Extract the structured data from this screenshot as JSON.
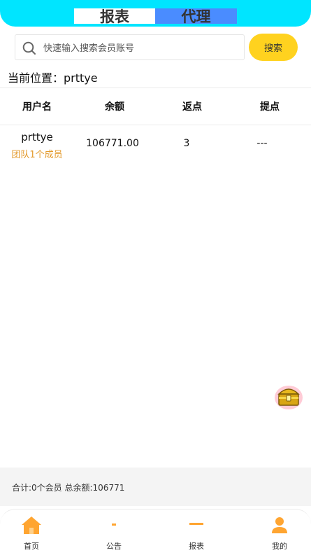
{
  "header": {
    "tabs": [
      {
        "label": "报表"
      },
      {
        "label": "代理"
      }
    ]
  },
  "search": {
    "placeholder": "快速输入搜索会员账号",
    "button_label": "搜索"
  },
  "location": {
    "text": "当前位置：prttye"
  },
  "table": {
    "columns": [
      "用户名",
      "余额",
      "返点",
      "提点"
    ],
    "rows": [
      {
        "username": "prttye",
        "team": "团队1个成员",
        "balance": "106771.00",
        "rebate": "3",
        "commission": "---"
      }
    ]
  },
  "summary": {
    "text": "合计:0个会员 总余额:106771"
  },
  "bottom_nav": {
    "items": [
      {
        "label": "首页",
        "icon": "home-icon"
      },
      {
        "label": "公告",
        "icon": "announcement-icon"
      },
      {
        "label": "报表",
        "icon": "report-icon"
      },
      {
        "label": "我的",
        "icon": "user-icon"
      }
    ]
  },
  "colors": {
    "header": "#00e5ff",
    "active_tab": "#4a8cff",
    "search_button": "#ffd21f",
    "team_text": "#e39a2c",
    "nav_icon": "#ffa531"
  }
}
